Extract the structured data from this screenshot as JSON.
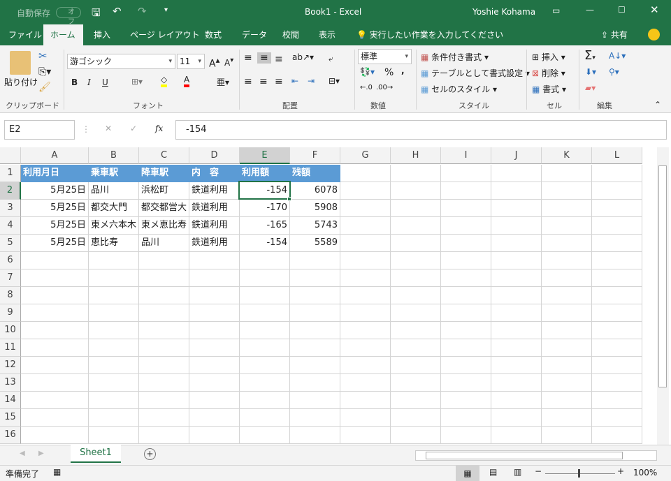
{
  "titlebar": {
    "autosave": "自動保存",
    "autosave_state": "オフ",
    "title": "Book1 - Excel",
    "user": "Yoshie Kohama"
  },
  "tabs": [
    "ファイル",
    "ホーム",
    "挿入",
    "ページ レイアウト",
    "数式",
    "データ",
    "校閲",
    "表示"
  ],
  "active_tab": "ホーム",
  "tell_me": "実行したい作業を入力してください",
  "share": "共有",
  "ribbon": {
    "clipboard": {
      "paste": "貼り付け",
      "label": "クリップボード"
    },
    "font": {
      "name": "游ゴシック",
      "size": "11",
      "bold": "B",
      "italic": "I",
      "underline": "U",
      "label": "フォント",
      "fill_color": "#ffff00",
      "font_color": "#ff0000"
    },
    "alignment": {
      "label": "配置"
    },
    "number": {
      "format": "標準",
      "percent": "%",
      "comma": ",",
      "label": "数値"
    },
    "styles": {
      "conditional": "条件付き書式",
      "table": "テーブルとして書式設定",
      "cell_styles": "セルのスタイル",
      "label": "スタイル"
    },
    "cells": {
      "insert": "挿入",
      "delete": "削除",
      "format": "書式",
      "label": "セル"
    },
    "editing": {
      "label": "編集"
    }
  },
  "formula_bar": {
    "name_box": "E2",
    "fx": "fx",
    "value": "-154"
  },
  "columns": [
    "A",
    "B",
    "C",
    "D",
    "E",
    "F",
    "G",
    "H",
    "I",
    "J",
    "K",
    "L"
  ],
  "selected_column": "E",
  "selected_row": 2,
  "rows": [
    [
      "利用月日",
      "乗車駅",
      "降車駅",
      "内　容",
      "利用額",
      "残額"
    ],
    [
      "5月25日",
      "品川",
      "浜松町",
      "鉄道利用",
      "-154",
      "6078"
    ],
    [
      "5月25日",
      "都交大門",
      "都交都営大",
      "鉄道利用",
      "-170",
      "5908"
    ],
    [
      "5月25日",
      "東メ六本木",
      "東メ恵比寿",
      "鉄道利用",
      "-165",
      "5743"
    ],
    [
      "5月25日",
      "恵比寿",
      "品川",
      "鉄道利用",
      "-154",
      "5589"
    ]
  ],
  "row_numbers": [
    1,
    2,
    3,
    4,
    5,
    6,
    7,
    8,
    9,
    10,
    11,
    12,
    13,
    14,
    15,
    16
  ],
  "header_fill": "#5b9bd5",
  "sheet_tabs": [
    "Sheet1"
  ],
  "status": {
    "ready": "準備完了",
    "zoom": "100%"
  }
}
